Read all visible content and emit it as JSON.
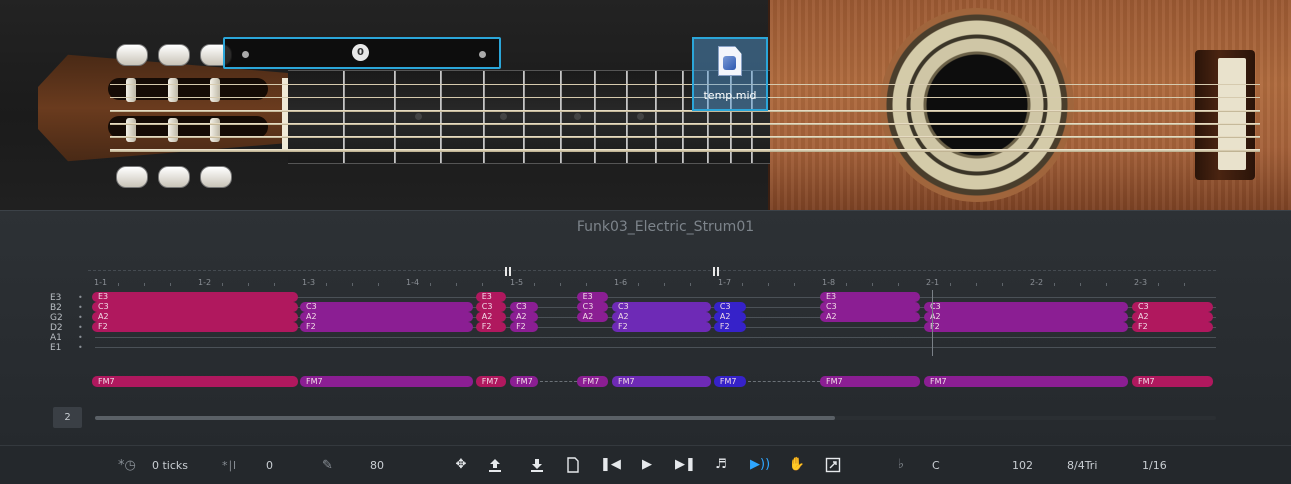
{
  "file_drag": {
    "name": "temp.mid"
  },
  "capo_selector": {
    "value": "0"
  },
  "editor": {
    "pattern_name": "Funk03_Electric_Strum01",
    "ruler_labels": [
      "1-1",
      "1-2",
      "1-3",
      "1-4",
      "1-5",
      "1-6",
      "1-7",
      "1-8",
      "2-1",
      "2-2",
      "2-3"
    ],
    "string_labels": [
      "E3",
      "B2",
      "G2",
      "D2",
      "A1",
      "E1"
    ],
    "page": "2",
    "scroll_position": 0.66
  },
  "notes": [
    {
      "lane": 0,
      "label": "E3",
      "color": "mag",
      "start": 0,
      "end": 2
    },
    {
      "lane": 1,
      "label": "C3",
      "color": "mag",
      "start": 0,
      "end": 2
    },
    {
      "lane": 2,
      "label": "A2",
      "color": "mag",
      "start": 0,
      "end": 2
    },
    {
      "lane": 3,
      "label": "F2",
      "color": "mag",
      "start": 0,
      "end": 2
    },
    {
      "lane": 1,
      "label": "C3",
      "color": "pur",
      "start": 2,
      "end": 3.68
    },
    {
      "lane": 2,
      "label": "A2",
      "color": "pur",
      "start": 2,
      "end": 3.68
    },
    {
      "lane": 3,
      "label": "F2",
      "color": "pur",
      "start": 2,
      "end": 3.68
    },
    {
      "lane": 0,
      "label": "E3",
      "color": "mag",
      "start": 3.69,
      "end": 4.0
    },
    {
      "lane": 1,
      "label": "C3",
      "color": "mag",
      "start": 3.69,
      "end": 4.0
    },
    {
      "lane": 2,
      "label": "A2",
      "color": "mag",
      "start": 3.69,
      "end": 4.0
    },
    {
      "lane": 3,
      "label": "F2",
      "color": "mag",
      "start": 3.69,
      "end": 4.0
    },
    {
      "lane": 1,
      "label": "C3",
      "color": "pur",
      "start": 4.02,
      "end": 4.31
    },
    {
      "lane": 2,
      "label": "A2",
      "color": "pur",
      "start": 4.02,
      "end": 4.31
    },
    {
      "lane": 3,
      "label": "F2",
      "color": "pur",
      "start": 4.02,
      "end": 4.31
    },
    {
      "lane": 0,
      "label": "E3",
      "color": "pur",
      "start": 4.66,
      "end": 4.98
    },
    {
      "lane": 1,
      "label": "C3",
      "color": "pur",
      "start": 4.66,
      "end": 4.98
    },
    {
      "lane": 2,
      "label": "A2",
      "color": "pur",
      "start": 4.66,
      "end": 4.98
    },
    {
      "lane": 1,
      "label": "C3",
      "color": "vio",
      "start": 5.0,
      "end": 5.97
    },
    {
      "lane": 2,
      "label": "A2",
      "color": "vio",
      "start": 5.0,
      "end": 5.97
    },
    {
      "lane": 3,
      "label": "F2",
      "color": "vio",
      "start": 5.0,
      "end": 5.97
    },
    {
      "lane": 1,
      "label": "C3",
      "color": "blu",
      "start": 5.98,
      "end": 6.31
    },
    {
      "lane": 2,
      "label": "A2",
      "color": "blu",
      "start": 5.98,
      "end": 6.31
    },
    {
      "lane": 3,
      "label": "F2",
      "color": "blu",
      "start": 5.98,
      "end": 6.31
    },
    {
      "lane": 0,
      "label": "E3",
      "color": "pur",
      "start": 7.0,
      "end": 7.98
    },
    {
      "lane": 1,
      "label": "C3",
      "color": "pur",
      "start": 7.0,
      "end": 7.98
    },
    {
      "lane": 2,
      "label": "A2",
      "color": "pur",
      "start": 7.0,
      "end": 7.98
    },
    {
      "lane": 1,
      "label": "C3",
      "color": "pur",
      "start": 8.0,
      "end": 9.98
    },
    {
      "lane": 2,
      "label": "A2",
      "color": "pur",
      "start": 8.0,
      "end": 9.98
    },
    {
      "lane": 3,
      "label": "F2",
      "color": "pur",
      "start": 8.0,
      "end": 9.98
    },
    {
      "lane": 1,
      "label": "C3",
      "color": "mag",
      "start": 10.0,
      "end": 10.8
    },
    {
      "lane": 2,
      "label": "A2",
      "color": "mag",
      "start": 10.0,
      "end": 10.8
    },
    {
      "lane": 3,
      "label": "F2",
      "color": "mag",
      "start": 10.0,
      "end": 10.8
    }
  ],
  "chords": [
    {
      "label": "FM7",
      "color": "mag",
      "start": 0,
      "end": 2
    },
    {
      "label": "FM7",
      "color": "pur",
      "start": 2,
      "end": 3.68
    },
    {
      "label": "FM7",
      "color": "mag",
      "start": 3.69,
      "end": 4.0
    },
    {
      "label": "FM7",
      "color": "pur",
      "start": 4.02,
      "end": 4.31
    },
    {
      "label": "FM7",
      "color": "pur",
      "start": 4.66,
      "end": 4.98
    },
    {
      "label": "FM7",
      "color": "vio",
      "start": 5.0,
      "end": 5.97
    },
    {
      "label": "FM7",
      "color": "blu",
      "start": 5.98,
      "end": 6.31
    },
    {
      "label": "FM7",
      "color": "pur",
      "start": 7.0,
      "end": 7.98
    },
    {
      "label": "FM7",
      "color": "pur",
      "start": 8.0,
      "end": 9.98
    },
    {
      "label": "FM7",
      "color": "mag",
      "start": 10.0,
      "end": 10.8
    }
  ],
  "pause_marks": [
    4,
    6
  ],
  "toolbar": {
    "offset_value": "0 ticks",
    "humanize_value": "0",
    "velocity_value": "80",
    "key_value": "C",
    "tempo_value": "102",
    "time_signature": "8/4Tri",
    "quantize": "1/16"
  },
  "colors": {
    "mag": "#b0185e",
    "pur": "#8b1e93",
    "vio": "#6e2ab6",
    "blu": "#3622c9",
    "accent": "#2ba6d9"
  }
}
